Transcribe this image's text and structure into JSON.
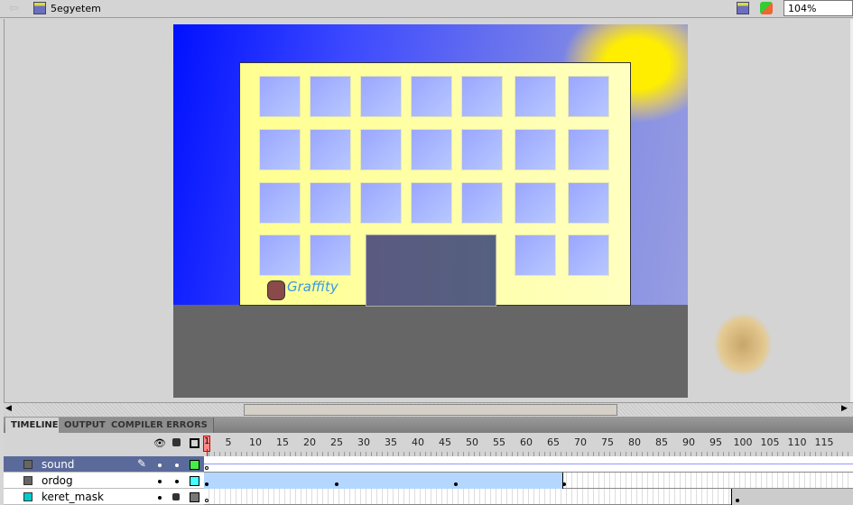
{
  "document": {
    "title": "5egyetem",
    "zoom": "104%"
  },
  "stage": {
    "graffiti_text": "Graffity",
    "sky_color": "#0010ff",
    "building_color": "#ffff99",
    "ground_color": "#666666"
  },
  "panel": {
    "tabs": [
      {
        "label": "TIMELINE",
        "active": true
      },
      {
        "label": "OUTPUT",
        "active": false
      },
      {
        "label": "COMPILER ERRORS",
        "active": false
      }
    ]
  },
  "timeline": {
    "current_frame": "1",
    "ticks": [
      "5",
      "10",
      "15",
      "20",
      "25",
      "30",
      "35",
      "40",
      "45",
      "50",
      "55",
      "60",
      "65",
      "70",
      "75",
      "80",
      "85",
      "90",
      "95",
      "100",
      "105",
      "110",
      "115"
    ],
    "layers": [
      {
        "name": "sound",
        "selected": true,
        "color": "#44ee44",
        "locked": false,
        "keyframes": [
          1
        ]
      },
      {
        "name": "ordog",
        "selected": false,
        "color": "#44ffff",
        "locked": false,
        "tween_end": 67,
        "keyframes": [
          1,
          25,
          47,
          67
        ]
      },
      {
        "name": "keret_mask",
        "selected": false,
        "color": "#777777",
        "locked": true,
        "keyframes": [
          1,
          99
        ]
      }
    ]
  }
}
